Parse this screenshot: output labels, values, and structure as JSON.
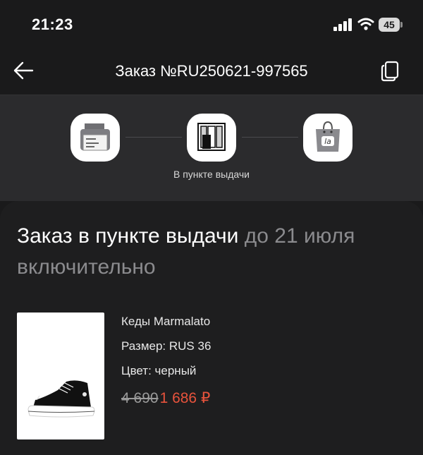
{
  "status_bar": {
    "time": "21:23",
    "battery_level": "45"
  },
  "header": {
    "title": "Заказ №RU250621-997565",
    "back_icon": "arrow-left-icon",
    "copy_icon": "copy-icon"
  },
  "progress": {
    "steps": [
      {
        "icon": "printer-icon",
        "active": false
      },
      {
        "icon": "pickup-point-icon",
        "active": true
      },
      {
        "icon": "shopping-bag-icon",
        "active": false
      }
    ],
    "current_label": "В пункте выдачи"
  },
  "order": {
    "status_main": "Заказ в пункте выдачи",
    "status_detail": "до 21 июля включительно"
  },
  "product": {
    "name": "Кеды Marmalato",
    "size": "Размер: RUS 36",
    "color": "Цвет: черный",
    "old_price": "4 690",
    "new_price": "1 686 ₽"
  },
  "colors": {
    "background": "#1a1a1b",
    "panel": "#2b2b2d",
    "accent_price": "#e8533c",
    "muted_text": "#8b8b8e"
  }
}
